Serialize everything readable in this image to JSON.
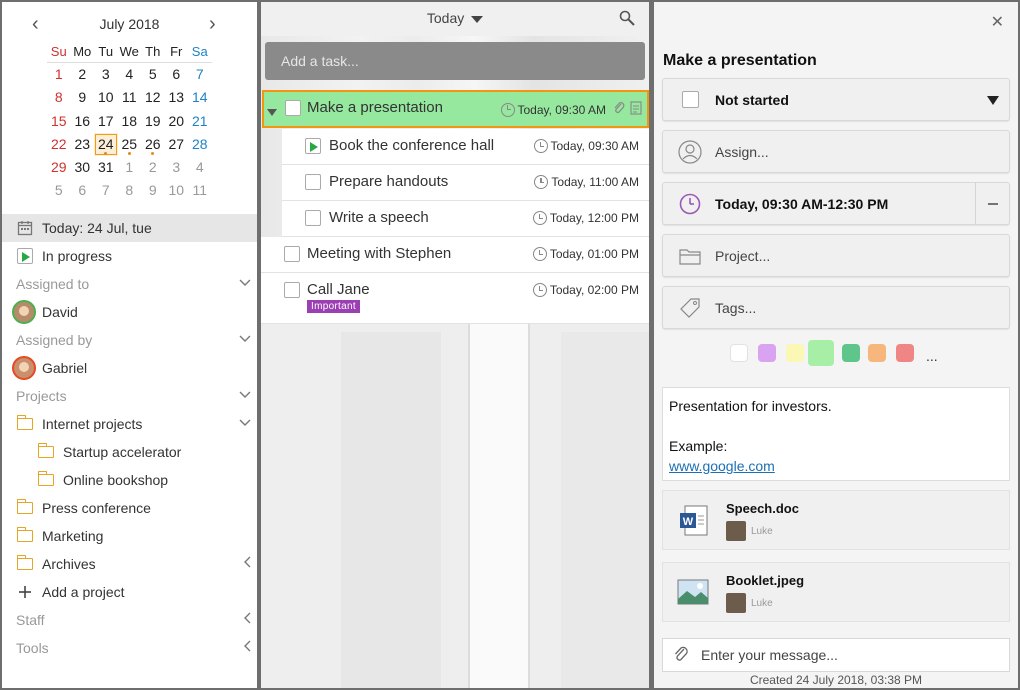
{
  "calendar": {
    "title": "July 2018",
    "weekdays": [
      "Su",
      "Mo",
      "Tu",
      "We",
      "Th",
      "Fr",
      "Sa"
    ],
    "days": [
      [
        "1",
        "2",
        "3",
        "4",
        "5",
        "6",
        "7"
      ],
      [
        "8",
        "9",
        "10",
        "11",
        "12",
        "13",
        "14"
      ],
      [
        "15",
        "16",
        "17",
        "18",
        "19",
        "20",
        "21"
      ],
      [
        "22",
        "23",
        "24",
        "25",
        "26",
        "27",
        "28"
      ],
      [
        "29",
        "30",
        "31",
        "1",
        "2",
        "3",
        "4"
      ],
      [
        "5",
        "6",
        "7",
        "8",
        "9",
        "10",
        "11"
      ]
    ],
    "today": "24"
  },
  "sidebar": {
    "today_label": "Today: 24 Jul, tue",
    "in_progress": "In progress",
    "assigned_to": "Assigned to",
    "assigned_to_user": "David",
    "assigned_by": "Assigned by",
    "assigned_by_user": "Gabriel",
    "projects": "Projects",
    "internet_projects": "Internet projects",
    "startup_accelerator": "Startup accelerator",
    "online_bookshop": "Online bookshop",
    "press_conference": "Press conference",
    "marketing": "Marketing",
    "archives": "Archives",
    "add_project": "Add a project",
    "staff": "Staff",
    "tools": "Tools"
  },
  "tasklist": {
    "view": "Today",
    "add_placeholder": "Add a task...",
    "tasks": [
      {
        "title": "Make a presentation",
        "time": "Today, 09:30 AM"
      },
      {
        "title": "Book the conference hall",
        "time": "Today, 09:30 AM"
      },
      {
        "title": "Prepare handouts",
        "time": "Today, 11:00 AM"
      },
      {
        "title": "Write a speech",
        "time": "Today, 12:00 PM"
      },
      {
        "title": "Meeting with Stephen",
        "time": "Today, 01:00 PM"
      },
      {
        "title": "Call Jane",
        "time": "Today, 02:00 PM",
        "tag": "Important"
      }
    ]
  },
  "detail": {
    "title": "Make a presentation",
    "status": "Not started",
    "assign": "Assign...",
    "time": "Today, 09:30 AM-12:30 PM",
    "project": "Project...",
    "tags": "Tags...",
    "colors": [
      "#ffffff",
      "#d9a3f2",
      "#fbf7b4",
      "#a7eea7",
      "#5ec68b",
      "#f7b67c",
      "#f08585"
    ],
    "more": "...",
    "notes_line1": "Presentation for investors.",
    "notes_line2": "Example:",
    "notes_link": "www.google.com",
    "attachments": [
      {
        "name": "Speech.doc",
        "user": "Luke"
      },
      {
        "name": "Booklet.jpeg",
        "user": "Luke"
      }
    ],
    "message_placeholder": "Enter your message...",
    "created": "Created 24 July 2018, 03:38 PM"
  }
}
